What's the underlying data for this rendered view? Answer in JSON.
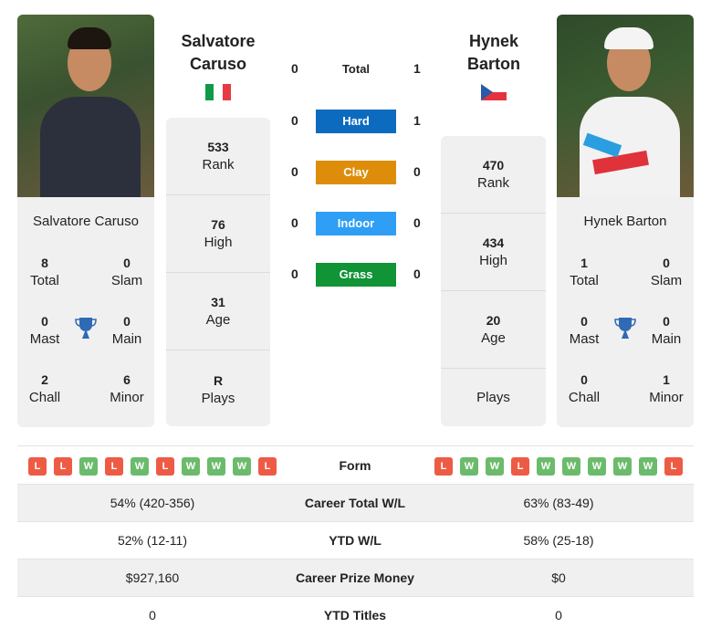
{
  "player1": {
    "name": "Salvatore Caruso",
    "name_line1": "Salvatore",
    "name_line2": "Caruso",
    "country_flag": "italy-flag",
    "rank": "533",
    "rank_label": "Rank",
    "high": "76",
    "high_label": "High",
    "age": "31",
    "age_label": "Age",
    "plays": "R",
    "plays_label": "Plays",
    "titles": {
      "total": "8",
      "total_label": "Total",
      "slam": "0",
      "slam_label": "Slam",
      "mast": "0",
      "mast_label": "Mast",
      "main": "0",
      "main_label": "Main",
      "chall": "2",
      "chall_label": "Chall",
      "minor": "6",
      "minor_label": "Minor"
    },
    "form": [
      "L",
      "L",
      "W",
      "L",
      "W",
      "L",
      "W",
      "W",
      "W",
      "L"
    ]
  },
  "player2": {
    "name": "Hynek Barton",
    "name_line1": "Hynek",
    "name_line2": "Barton",
    "country_flag": "czech-flag",
    "rank": "470",
    "rank_label": "Rank",
    "high": "434",
    "high_label": "High",
    "age": "20",
    "age_label": "Age",
    "plays": "",
    "plays_label": "Plays",
    "titles": {
      "total": "1",
      "total_label": "Total",
      "slam": "0",
      "slam_label": "Slam",
      "mast": "0",
      "mast_label": "Mast",
      "main": "0",
      "main_label": "Main",
      "chall": "0",
      "chall_label": "Chall",
      "minor": "1",
      "minor_label": "Minor"
    },
    "form": [
      "L",
      "W",
      "W",
      "L",
      "W",
      "W",
      "W",
      "W",
      "W",
      "L"
    ]
  },
  "h2h": [
    {
      "label": "Total",
      "left": "0",
      "right": "1",
      "color": ""
    },
    {
      "label": "Hard",
      "left": "0",
      "right": "1",
      "color": "#0c6bbf"
    },
    {
      "label": "Clay",
      "left": "0",
      "right": "0",
      "color": "#de8d0b"
    },
    {
      "label": "Indoor",
      "left": "0",
      "right": "0",
      "color": "#2f9ef5"
    },
    {
      "label": "Grass",
      "left": "0",
      "right": "0",
      "color": "#109435"
    }
  ],
  "form_label": "Form",
  "stats": [
    {
      "label": "Career Total W/L",
      "left": "54% (420-356)",
      "right": "63% (83-49)"
    },
    {
      "label": "YTD W/L",
      "left": "52% (12-11)",
      "right": "58% (25-18)"
    },
    {
      "label": "Career Prize Money",
      "left": "$927,160",
      "right": "$0"
    },
    {
      "label": "YTD Titles",
      "left": "0",
      "right": "0"
    }
  ]
}
